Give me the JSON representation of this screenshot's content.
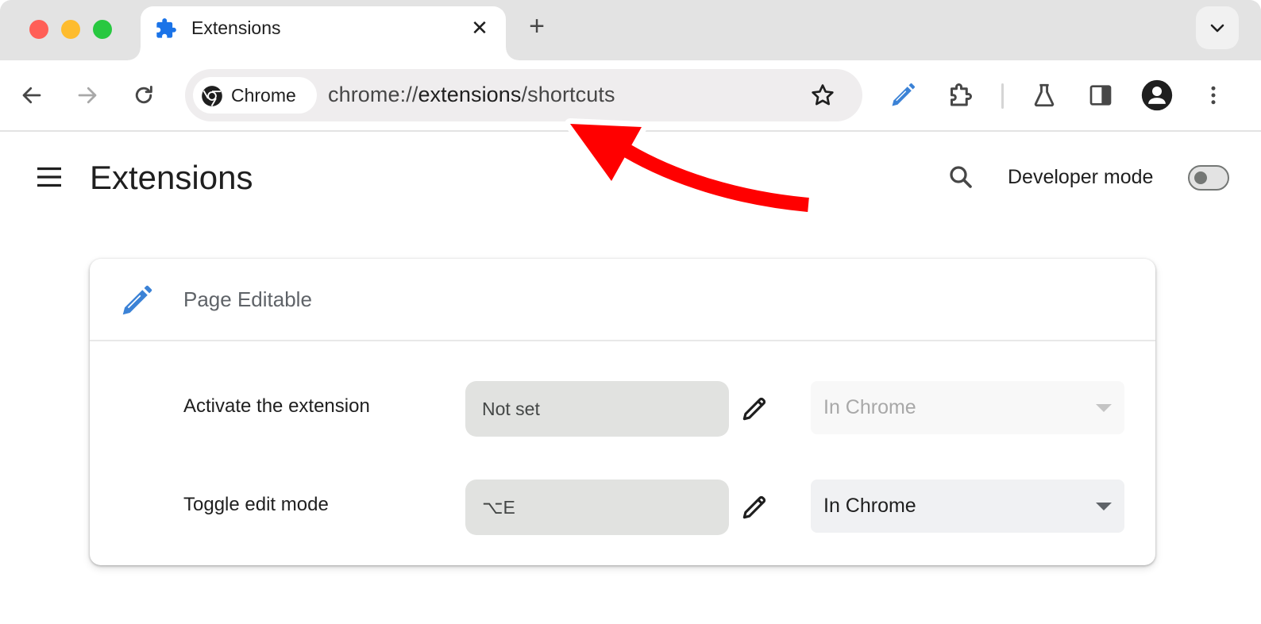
{
  "window": {
    "traffic_lights": [
      "close",
      "minimize",
      "zoom"
    ]
  },
  "tab": {
    "title": "Extensions",
    "icon": "puzzle-piece-icon",
    "close_glyph": "✕",
    "new_tab_glyph": "+"
  },
  "toolbar": {
    "back_icon": "arrow-left-icon",
    "forward_icon": "arrow-right-icon",
    "reload_icon": "reload-icon",
    "chip_label": "Chrome",
    "url_scheme": "chrome://",
    "url_host": "extensions",
    "url_path": "/shortcuts",
    "bookmark_icon": "star-icon",
    "extension_buttons": [
      "page-editable-pencil-icon",
      "extensions-puzzle-icon"
    ],
    "right_buttons": [
      "labs-flask-icon",
      "side-panel-icon",
      "profile-avatar-icon",
      "more-vertical-icon"
    ]
  },
  "header": {
    "title": "Extensions",
    "developer_mode_label": "Developer mode",
    "developer_mode_on": false
  },
  "extension": {
    "name": "Page Editable",
    "accent_color": "#3b82d6",
    "commands": [
      {
        "label": "Activate the extension",
        "shortcut": "Not set",
        "scope": "In Chrome",
        "scope_enabled": false
      },
      {
        "label": "Toggle edit mode",
        "shortcut": "⌥E",
        "scope": "In Chrome",
        "scope_enabled": true
      }
    ]
  },
  "annotation": {
    "type": "arrow",
    "color": "#ff0000",
    "points_to": "address-bar-url"
  }
}
